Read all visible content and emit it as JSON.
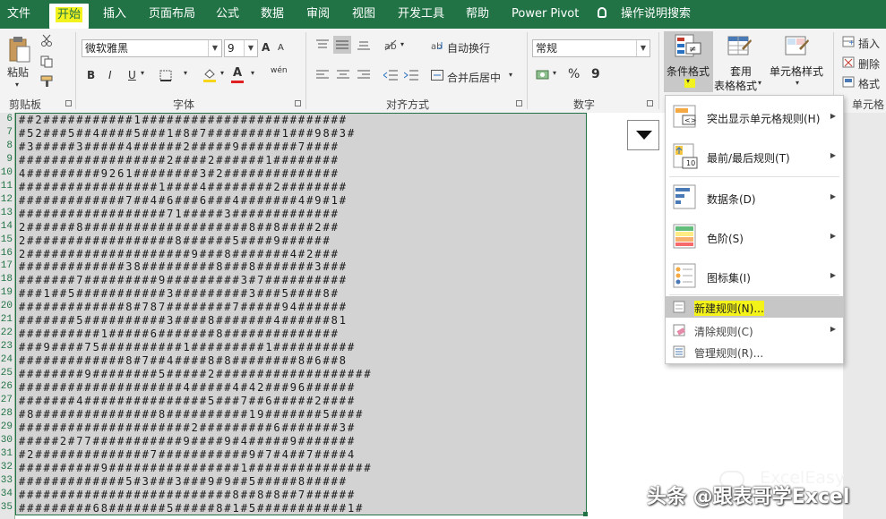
{
  "menubar": {
    "tabs": [
      "文件",
      "开始",
      "插入",
      "页面布局",
      "公式",
      "数据",
      "审阅",
      "视图",
      "开发工具",
      "帮助",
      "Power Pivot"
    ],
    "active_tab": "开始",
    "tell_me": "操作说明搜索",
    "bg_color": "#217346",
    "highlight_color": "#f2f21e"
  },
  "ribbon": {
    "clipboard": {
      "paste": "粘贴",
      "group": "剪贴板"
    },
    "font": {
      "font_name": "微软雅黑",
      "font_size": "9",
      "bold": "B",
      "italic": "I",
      "underline": "U",
      "font_color_glyph": "A",
      "phonetic": "wén",
      "grow": "A",
      "shrink": "A",
      "group": "字体"
    },
    "alignment": {
      "wrap": "自动换行",
      "merge": "合并后居中",
      "group": "对齐方式"
    },
    "number": {
      "format": "常规",
      "percent": "%",
      "comma": "9",
      "group": "数字"
    },
    "styles": {
      "conditional": "条件格式",
      "table_1": "套用",
      "table_2": "表格格式",
      "cell_styles": "单元格样式",
      "group": "样式"
    },
    "cells": {
      "insert": "插入",
      "delete": "删除",
      "format": "格式",
      "group": "单元格"
    }
  },
  "sheet": {
    "row_numbers": [
      "6",
      "7",
      "8",
      "9",
      "10",
      "11",
      "12",
      "13",
      "14",
      "15",
      "16",
      "17",
      "18",
      "19",
      "20",
      "21",
      "22",
      "23",
      "24",
      "25",
      "26",
      "27",
      "28",
      "29",
      "30",
      "31",
      "32",
      "33",
      "34",
      "35"
    ],
    "rows": [
      "##2###########1#########################",
      "#52###5##4####5###1#8#7#########1###98#3#",
      "#3#####3#####4######2#####9#######7####",
      "##################2####2######1########",
      "4#########9261########3#2##############",
      "#################1####4########2########",
      "#############7##4#6###6###4#######4#9#1#",
      "##################71#####3#############",
      "2######8####################8##8####2##",
      "2##################8######5####9######",
      "2####################9###8#######4#2###",
      "#############38#########8###8#######3###",
      "#######7#########9#########3#7##########",
      "###1##5###########3#########3###5####8#",
      "#############8#787########7#####94######",
      "#######5##########3####8#######4######81",
      "##########1#####6#######8##############",
      "###9####75##########1#########1##########",
      "#############8#7##4####8#8########8#6##8",
      "########9########5#####2###################",
      "####################4#####4#42###96######",
      "#######4###############5###7##6#####2####",
      "#8###############8##########19#######5####",
      "#####################2#########6#######3#",
      "#####2#77###########9####9#4#####9#######",
      "#2##############7###########9#7#4##7####4",
      "##########9################1###############",
      "#############5#3###3###9#9##5#####8#####",
      "##########################8##8#8##7######",
      "#########68#######5#####8#1#5###########1#"
    ]
  },
  "cf_menu": {
    "items": [
      {
        "label": "突出显示单元格规则(H)",
        "has_sub": true
      },
      {
        "label": "最前/最后规则(T)",
        "has_sub": true
      },
      {
        "label": "数据条(D)",
        "has_sub": true
      },
      {
        "label": "色阶(S)",
        "has_sub": true
      },
      {
        "label": "图标集(I)",
        "has_sub": true
      },
      {
        "label": "新建规则(N)...",
        "has_sub": false
      },
      {
        "label": "清除规则(C)",
        "has_sub": true
      },
      {
        "label": "管理规则(R)...",
        "has_sub": false
      }
    ],
    "top10_badge": "10"
  },
  "watermark": {
    "brand": "ExcelEasy",
    "credit": "头条 @跟表哥学Excel"
  }
}
